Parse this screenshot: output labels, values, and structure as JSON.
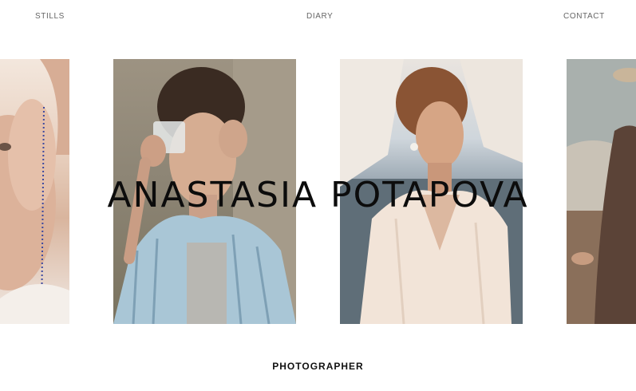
{
  "nav": {
    "stills": "STILLS",
    "diary": "DIARY",
    "contact": "CONTACT"
  },
  "hero": {
    "name": "ANASTASIA POTAPOVA",
    "role": "PHOTOGRAPHER"
  },
  "gallery": {
    "photo_count": 4
  }
}
